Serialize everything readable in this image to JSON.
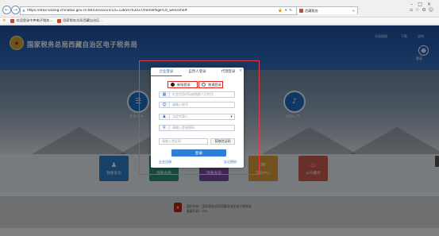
{
  "browser": {
    "url": "https://etax.xizang.chinatax.gov.cn:8443/xxxxxTc1d=12850763037/homePage!Ctl_welcome#",
    "tab_title": "西藏税务",
    "favorites": [
      {
        "label": "欢迎登录中央电子税务..."
      },
      {
        "label": "国家税务总局西藏自治区..."
      }
    ]
  },
  "header": {
    "title": "国家税务总局西藏自治区电子税务局",
    "links": [
      "分局链接",
      "下载",
      "咨询"
    ],
    "login_label": "登录"
  },
  "hero": {
    "items": [
      {
        "label": "我的待办",
        "icon": "document-icon"
      },
      {
        "label": "通知公告",
        "icon": "bell-icon"
      }
    ]
  },
  "services": [
    {
      "label": "我要查询",
      "color": "#2c7ec5",
      "icon": "person-icon"
    },
    {
      "label": "我要办税",
      "color": "#2c8f7a",
      "icon": "stamp-icon"
    },
    {
      "label": "我要查询",
      "color": "#7b4aa8",
      "icon": "chart-icon"
    },
    {
      "label": "互动中心",
      "color": "#d99b3a",
      "icon": "chat-icon"
    },
    {
      "label": "公众服务",
      "color": "#c95a4f",
      "icon": "service-icon"
    }
  ],
  "footer": {
    "line1": "版权所有：国家税务总局西藏自治区电子税务局",
    "line2": "备案号码：ICP..."
  },
  "login_modal": {
    "tabs": [
      "企业登录",
      "自然人登录",
      "代理登录"
    ],
    "active_tab": 0,
    "radio_options": [
      {
        "label": "新版登录",
        "checked": true
      },
      {
        "label": "普通登录",
        "checked": false
      }
    ],
    "fields": [
      {
        "placeholder": "社会信用代码或纳税人识别号",
        "icon": "building-icon",
        "dropdown": false
      },
      {
        "placeholder": "请输入账号",
        "icon": "user-icon",
        "dropdown": false
      },
      {
        "placeholder": "法定代表人",
        "icon": "role-icon",
        "dropdown": true
      },
      {
        "placeholder": "请输入登录密码",
        "icon": "lock-icon",
        "dropdown": false
      },
      {
        "placeholder": "请输入...",
        "icon": "phone-icon",
        "dropdown": false
      }
    ],
    "sms_placeholder": "请输入验证码",
    "sms_button": "获取验证码",
    "login_button": "登录",
    "register_link": "企业注册",
    "forgot_link": "忘记密码"
  }
}
